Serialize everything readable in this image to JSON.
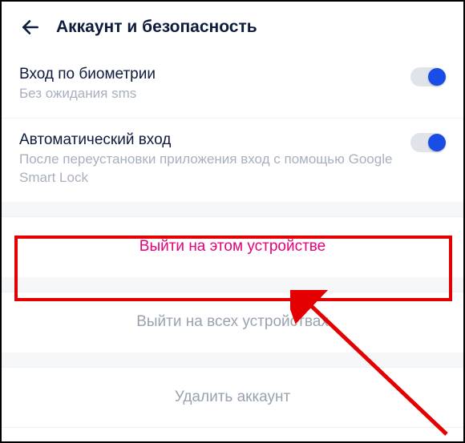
{
  "header": {
    "title": "Аккаунт и безопасность"
  },
  "settings": {
    "biometric": {
      "title": "Вход по биометрии",
      "desc": "Без ожидания sms",
      "on": true
    },
    "autologin": {
      "title": "Автоматический вход",
      "desc": "После переустановки приложения вход с помощью Google Smart Lock",
      "on": true
    }
  },
  "actions": {
    "logout_device": "Выйти на этом устройстве",
    "logout_all": "Выйти на всех устройствах",
    "delete_account": "Удалить аккаунт"
  },
  "annotation": {
    "highlight_color": "#e40000",
    "arrow_color": "#e40000"
  }
}
